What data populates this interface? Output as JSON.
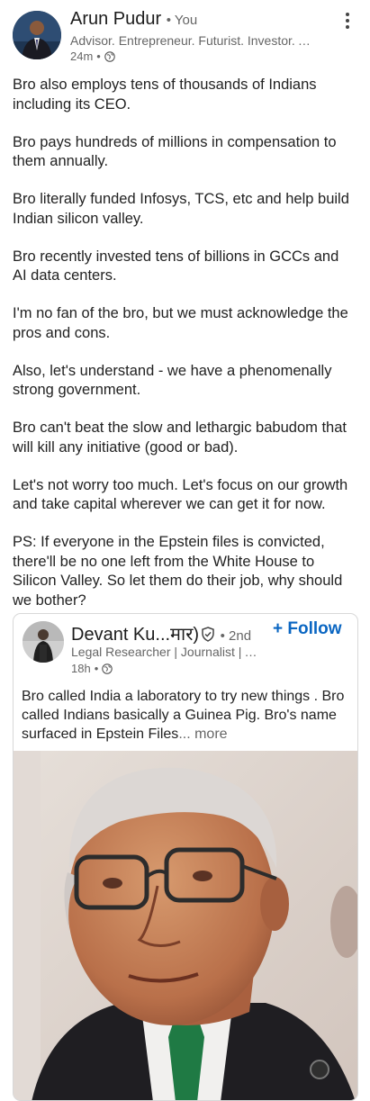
{
  "author": {
    "name": "Arun Pudur",
    "you_label": "• You",
    "headline": "Advisor. Entrepreneur. Futurist. Investor. Angel.",
    "time": "24m"
  },
  "post": {
    "paragraphs": [
      "Bro also employs tens of thousands of Indians including its CEO.",
      "Bro pays hundreds of millions in compensation to them annually.",
      "Bro literally funded Infosys, TCS, etc and help build Indian silicon valley.",
      "Bro recently invested tens of billions in GCCs and AI data centers.",
      "I'm no fan of the bro, but we must acknowledge the pros and cons.",
      "Also, let's understand - we have a phenomenally strong government.",
      "Bro can't beat the slow and lethargic babudom that will kill any initiative (good or bad).",
      "Let's not worry too much. Let's focus on our growth and take capital wherever we can get it for now.",
      "PS: If everyone in the Epstein files is convicted, there'll be no one left from the White House to Silicon Valley. So let them do their job, why should we bother?"
    ]
  },
  "quoted": {
    "name": "Devant Ku...मार)",
    "degree": "• 2nd",
    "follow_label": "+ Follow",
    "headline": "Legal Researcher | Journalist | Author",
    "time": "18h",
    "text": "Bro called India a laboratory to try new things . Bro called Indians basically a Guinea Pig. Bro's name surfaced in Epstein Files",
    "more_label": "... more"
  },
  "colors": {
    "link_blue": "#0a66c2",
    "muted": "#666666"
  }
}
